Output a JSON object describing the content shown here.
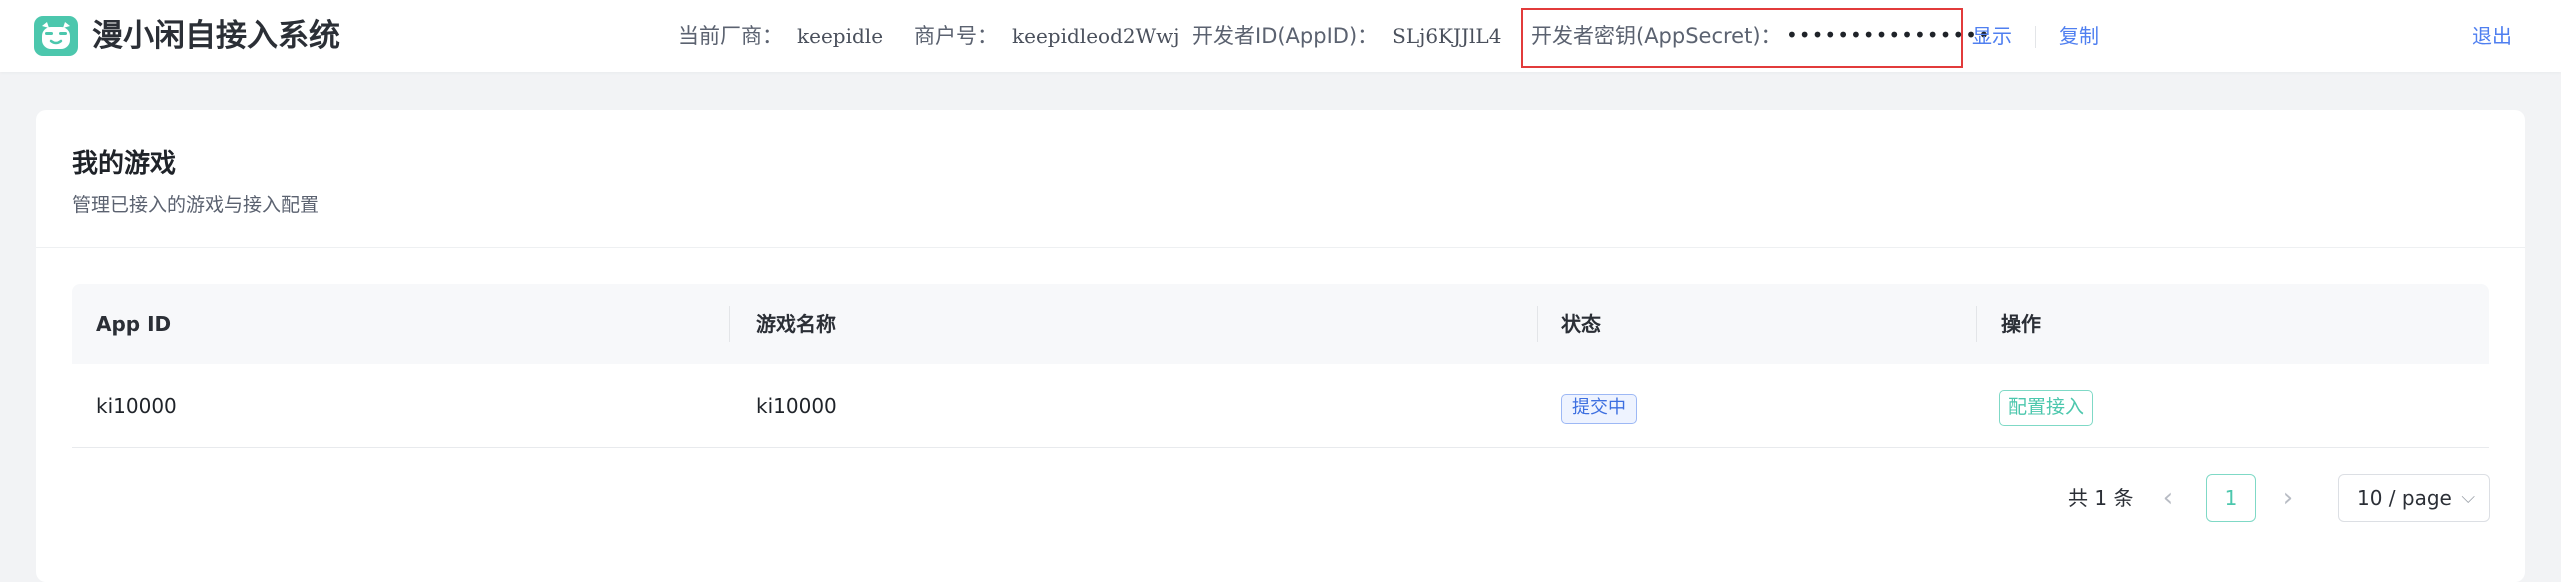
{
  "header": {
    "app_title": "漫小闲自接入系统",
    "vendor_label": "当前厂商：",
    "vendor_value": "keepidle",
    "merchant_label": "商户号：",
    "merchant_value": "keepidleod2Wwj",
    "appid_label": "开发者ID(AppID)：",
    "appid_value": "SLj6KJJlL4",
    "secret_label": "开发者密钥(AppSecret)：",
    "secret_value": "••••••••••••••••",
    "show_label": "显示",
    "copy_label": "复制",
    "logout_label": "退出",
    "icon": "mascot-logo-icon"
  },
  "main": {
    "title": "我的游戏",
    "subtitle": "管理已接入的游戏与接入配置",
    "table": {
      "columns": [
        "App ID",
        "游戏名称",
        "状态",
        "操作"
      ],
      "rows": [
        {
          "app_id": "ki10000",
          "game_name": "ki10000",
          "status": "提交中",
          "action": "配置接入"
        }
      ]
    },
    "pagination": {
      "total": "共 1 条",
      "current_page": "1",
      "page_size": "10 / page",
      "prev_icon": "chevron-left-icon",
      "next_icon": "chevron-right-icon"
    }
  },
  "colors": {
    "accent": "#4cc7ad",
    "link": "#4f7ff0",
    "highlight_border": "#e23b3b",
    "status_tag": "#3d6fe0"
  }
}
